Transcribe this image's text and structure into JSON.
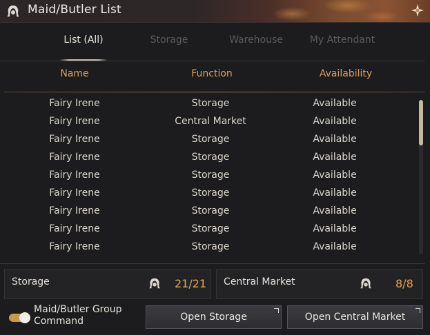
{
  "window": {
    "title": "Maid/Butler List"
  },
  "tabs": [
    {
      "label": "List (All)",
      "active": true
    },
    {
      "label": "Storage",
      "active": false
    },
    {
      "label": "Warehouse",
      "active": false
    },
    {
      "label": "My Attendant",
      "active": false
    }
  ],
  "columns": {
    "name": "Name",
    "function": "Function",
    "availability": "Availability"
  },
  "rows": [
    {
      "name": "Fairy Irene",
      "function": "Storage",
      "availability": "Available"
    },
    {
      "name": "Fairy Irene",
      "function": "Central Market",
      "availability": "Available"
    },
    {
      "name": "Fairy Irene",
      "function": "Storage",
      "availability": "Available"
    },
    {
      "name": "Fairy Irene",
      "function": "Storage",
      "availability": "Available"
    },
    {
      "name": "Fairy Irene",
      "function": "Storage",
      "availability": "Available"
    },
    {
      "name": "Fairy Irene",
      "function": "Storage",
      "availability": "Available"
    },
    {
      "name": "Fairy Irene",
      "function": "Storage",
      "availability": "Available"
    },
    {
      "name": "Fairy Irene",
      "function": "Storage",
      "availability": "Available"
    },
    {
      "name": "Fairy Irene",
      "function": "Storage",
      "availability": "Available"
    }
  ],
  "counters": {
    "storage": {
      "label": "Storage",
      "value": "21/21"
    },
    "central_market": {
      "label": "Central Market",
      "value": "8/8"
    }
  },
  "group_command": {
    "line1": "Maid/Butler Group",
    "line2": "Command",
    "enabled": true
  },
  "buttons": {
    "open_storage": "Open Storage",
    "open_central_market": "Open Central Market"
  },
  "icons": {
    "title": "maid-head-icon",
    "corner": "ornament-flower-icon"
  },
  "colors": {
    "accent": "#d9a15c",
    "counter_value": "#e2a64c",
    "toggle_on": "#c79a4a"
  }
}
